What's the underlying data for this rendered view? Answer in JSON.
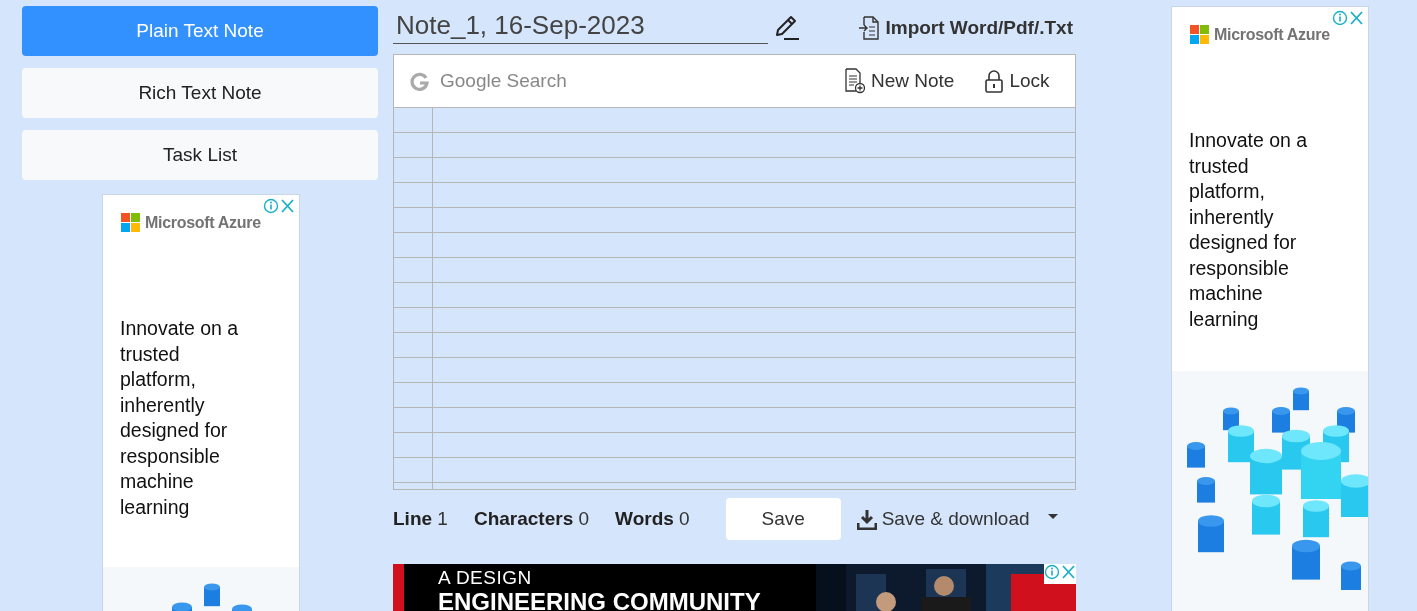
{
  "nav": [
    {
      "label": "Plain Text Note",
      "selected": true
    },
    {
      "label": "Rich Text Note",
      "selected": false
    },
    {
      "label": "Task List",
      "selected": false
    }
  ],
  "left_ad": {
    "brand": "Microsoft Azure",
    "headline": "Innovate on a trusted platform, inherently designed for responsible machine learning"
  },
  "note": {
    "title": "Note_1, 16-Sep-2023",
    "import_label": "Import Word/Pdf/.Txt",
    "search_placeholder": "Google Search",
    "new_note": "New Note",
    "lock": "Lock"
  },
  "stats": [
    {
      "label": "Line",
      "value": "1"
    },
    {
      "label": "Characters",
      "value": "0"
    },
    {
      "label": "Words",
      "value": "0"
    }
  ],
  "save_button": "Save",
  "download_button": "Save & download",
  "banner_ad": {
    "lines": [
      "A DESIGN",
      "ENGINEERING COMMUNITY"
    ]
  },
  "right_ad": {
    "brand": "Microsoft Azure",
    "headline": "Innovate on a trusted platform, inherently designed for responsible machine learning"
  }
}
